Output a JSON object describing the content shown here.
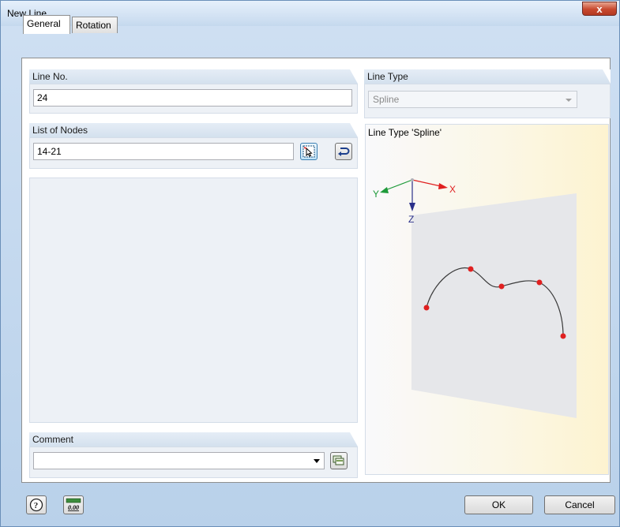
{
  "window": {
    "title": "New Line",
    "close_glyph": "x"
  },
  "tabs": [
    {
      "label": "General"
    },
    {
      "label": "Rotation"
    }
  ],
  "line_no": {
    "header": "Line No.",
    "value": "24"
  },
  "line_type": {
    "header": "Line Type",
    "selected": "Spline"
  },
  "list_of_nodes": {
    "header": "List of Nodes",
    "value": "14-21"
  },
  "comment": {
    "header": "Comment",
    "value": ""
  },
  "preview": {
    "label": "Line Type 'Spline'",
    "axes": {
      "x": "X",
      "y": "Y",
      "z": "Z"
    },
    "colors": {
      "x_axis": "#e02020",
      "y_axis": "#1e9a3a",
      "z_axis": "#2a2f8a",
      "node": "#e02020",
      "plane": "#e6e7ea"
    }
  },
  "buttons": {
    "ok": "OK",
    "cancel": "Cancel",
    "units_icon_text": "0.00"
  },
  "icons": [
    "close-icon",
    "pick-nodes-icon",
    "reverse-direction-icon",
    "comment-library-icon",
    "help-icon",
    "units-icon"
  ]
}
